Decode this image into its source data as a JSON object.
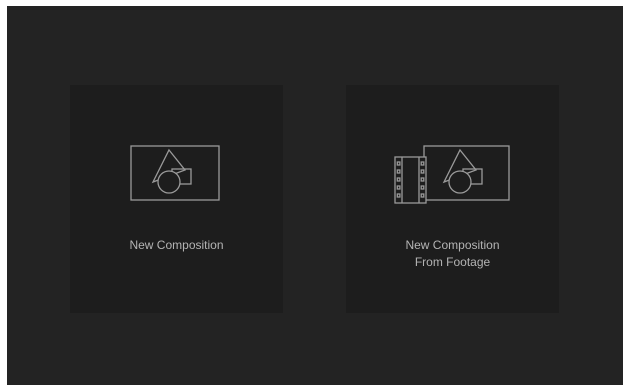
{
  "start_panel": {
    "cards": [
      {
        "label": "New Composition",
        "icon": "composition-icon"
      },
      {
        "label": "New Composition\nFrom Footage",
        "icon": "composition-from-footage-icon"
      }
    ]
  }
}
